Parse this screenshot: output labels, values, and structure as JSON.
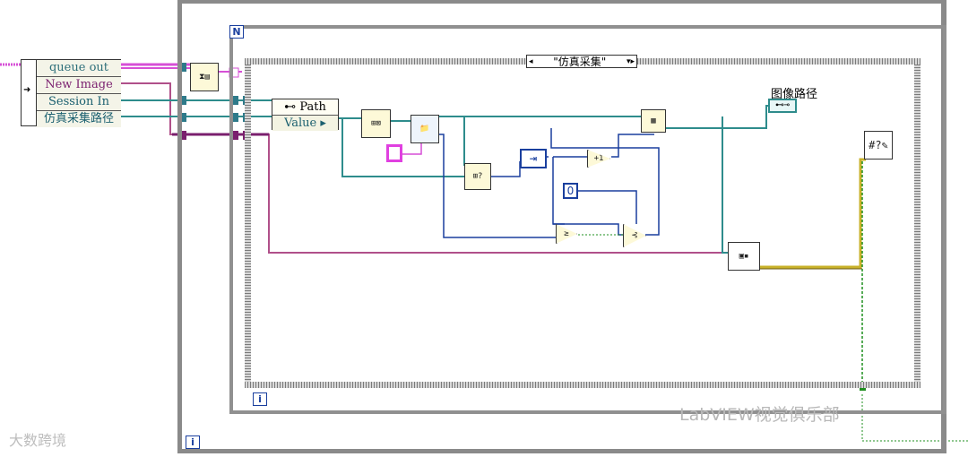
{
  "unbundle": {
    "items": [
      "queue out",
      "New Image",
      "Session In",
      "仿真采集路径"
    ]
  },
  "case_selector": {
    "value": "\"仿真采集\""
  },
  "loop_terminals": {
    "outer_count": "N",
    "inner_iteration": "i",
    "outer_iteration": "i"
  },
  "property_node": {
    "class_label": "Path",
    "property": "Value"
  },
  "constant_zero": "0",
  "path_indicator": {
    "label": "图像路径"
  },
  "watermarks": {
    "left": "大数跨境",
    "right": "LabVIEW视觉俱乐部"
  },
  "colors": {
    "wire_pink": "#d64fd6",
    "wire_teal": "#2e8c8c",
    "wire_blue": "#1a3f9e",
    "wire_purple": "#7a1f6e",
    "wire_yellow": "#c9b22a",
    "wire_green": "#1f8f1f"
  }
}
